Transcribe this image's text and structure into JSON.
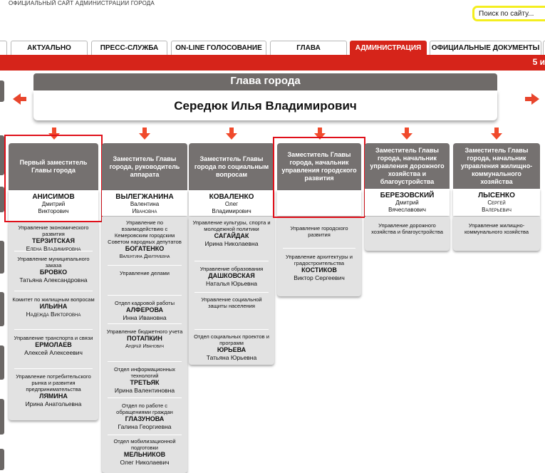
{
  "site": {
    "title": "ОФИЦИАЛЬНЫЙ САЙТ АДМИНИСТРАЦИИ ГОРОДА",
    "search_placeholder": "Поиск по сайту..."
  },
  "tabs": [
    {
      "label": "АКТУАЛЬНО"
    },
    {
      "label": "ПРЕСС-СЛУЖБА"
    },
    {
      "label": "ON-LINE ГОЛОСОВАНИЕ"
    },
    {
      "label": "ГЛАВА"
    },
    {
      "label": "АДМИНИСТРАЦИЯ"
    },
    {
      "label": "ОФИЦИАЛЬНЫЕ ДОКУМЕНТЫ"
    }
  ],
  "red_bar_text": "5 и",
  "head": {
    "title": "Глава города",
    "name": "Середюк Илья Владимирович"
  },
  "colors": {
    "accent": "#d6241a",
    "arrow": "#f04a2c",
    "header_grey": "#757170",
    "sub_grey": "#e2e2e2",
    "highlight": "#e0101a"
  },
  "deputies": [
    {
      "title": "Первый заместитель Главы города",
      "last": "АНИСИМОВ",
      "first": "Дмитрий",
      "middle": "Викторович",
      "subs": [
        {
          "dept": "Управление экономического развития",
          "last": "ТЕРЗИТСКАЯ",
          "name": "Елена Владимировна"
        },
        {
          "dept": "Управление муниципального заказа",
          "last": "БРОВКО",
          "name": "Татьяна Александровна"
        },
        {
          "dept": "Комитет по жилищным вопросам",
          "last": "ИЛЬИНА",
          "name": "Надежда Викторовна"
        },
        {
          "dept": "Управление транспорта и связи",
          "last": "ЕРМОЛАЕВ",
          "name": "Алексей Алексеевич"
        },
        {
          "dept": "Управление потребительского рынка и развития предпринимательства",
          "last": "ЛЯМИНА",
          "name": "Ирина Анатольевна"
        }
      ]
    },
    {
      "title": "Заместитель Главы города, руководитель аппарата",
      "last": "ВЫЛЕГЖАНИНА",
      "first": "Валентина",
      "middle": "Ивановна",
      "subs": [
        {
          "dept": "Управление по взаимодействию с Кемеровским городским Советом народных депутатов",
          "last": "БОГАТЕНКО",
          "name": "Валентина Дмитриевна"
        },
        {
          "dept": "Управление делами",
          "last": "",
          "name": ""
        },
        {
          "dept": "Отдел кадровой работы",
          "last": "АЛФЕРОВА",
          "name": "Инна Ивановна"
        },
        {
          "dept": "Управление бюджетного учета",
          "last": "ПОТАПКИН",
          "name": "Андрей Иванович"
        },
        {
          "dept": "Отдел информационных технологий",
          "last": "ТРЕТЬЯК",
          "name": "Ирина Валентиновна"
        },
        {
          "dept": "Отдел по работе с обращениями граждан",
          "last": "ГЛАЗУНОВА",
          "name": "Галина Георгиевна"
        },
        {
          "dept": "Отдел мобилизационной подготовки",
          "last": "МЕЛЬНИКОВ",
          "name": "Олег Николаевич"
        }
      ]
    },
    {
      "title": "Заместитель Главы города по социальным вопросам",
      "last": "КОВАЛЕНКО",
      "first": "Олег",
      "middle": "Владимирович",
      "subs": [
        {
          "dept": "Управление культуры, спорта и молодежной политики",
          "last": "САГАЙДАК",
          "name": "Ирина Николаевна"
        },
        {
          "dept": "Управление образования",
          "last": "ДАШКОВСКАЯ",
          "name": "Наталья Юрьевна"
        },
        {
          "dept": "Управление социальной защиты населения",
          "last": "",
          "name": ""
        },
        {
          "dept": "Отдел социальных проектов и программ",
          "last": "ЮРЬЕВА",
          "name": "Татьяна Юрьевна"
        }
      ]
    },
    {
      "title": "Заместитель Главы города, начальник управления городского развития",
      "last": "",
      "first": "",
      "middle": "",
      "subs": [
        {
          "dept": "Управление городского развития",
          "last": "",
          "name": ""
        },
        {
          "dept": "Управление архитектуры и градостроительства",
          "last": "КОСТИКОВ",
          "name": "Виктор Сергеевич"
        }
      ]
    },
    {
      "title": "Заместитель Главы города, начальник управления дорожного хозяйства и благоустройства",
      "last": "БЕРЕЗОВСКИЙ",
      "first": "Дмитрий",
      "middle": "Вячеславович",
      "subs": [
        {
          "dept": "Управление дорожного хозяйства и благоустройства",
          "last": "",
          "name": ""
        }
      ]
    },
    {
      "title": "Заместитель Главы города, начальник управления жилищно-коммунального хозяйства",
      "last": "ЛЫСЕНКО",
      "first": "Сергей",
      "middle": "Валерьевич",
      "subs": [
        {
          "dept": "Управление жилищно-коммунального хозяйства",
          "last": "",
          "name": ""
        }
      ]
    }
  ]
}
